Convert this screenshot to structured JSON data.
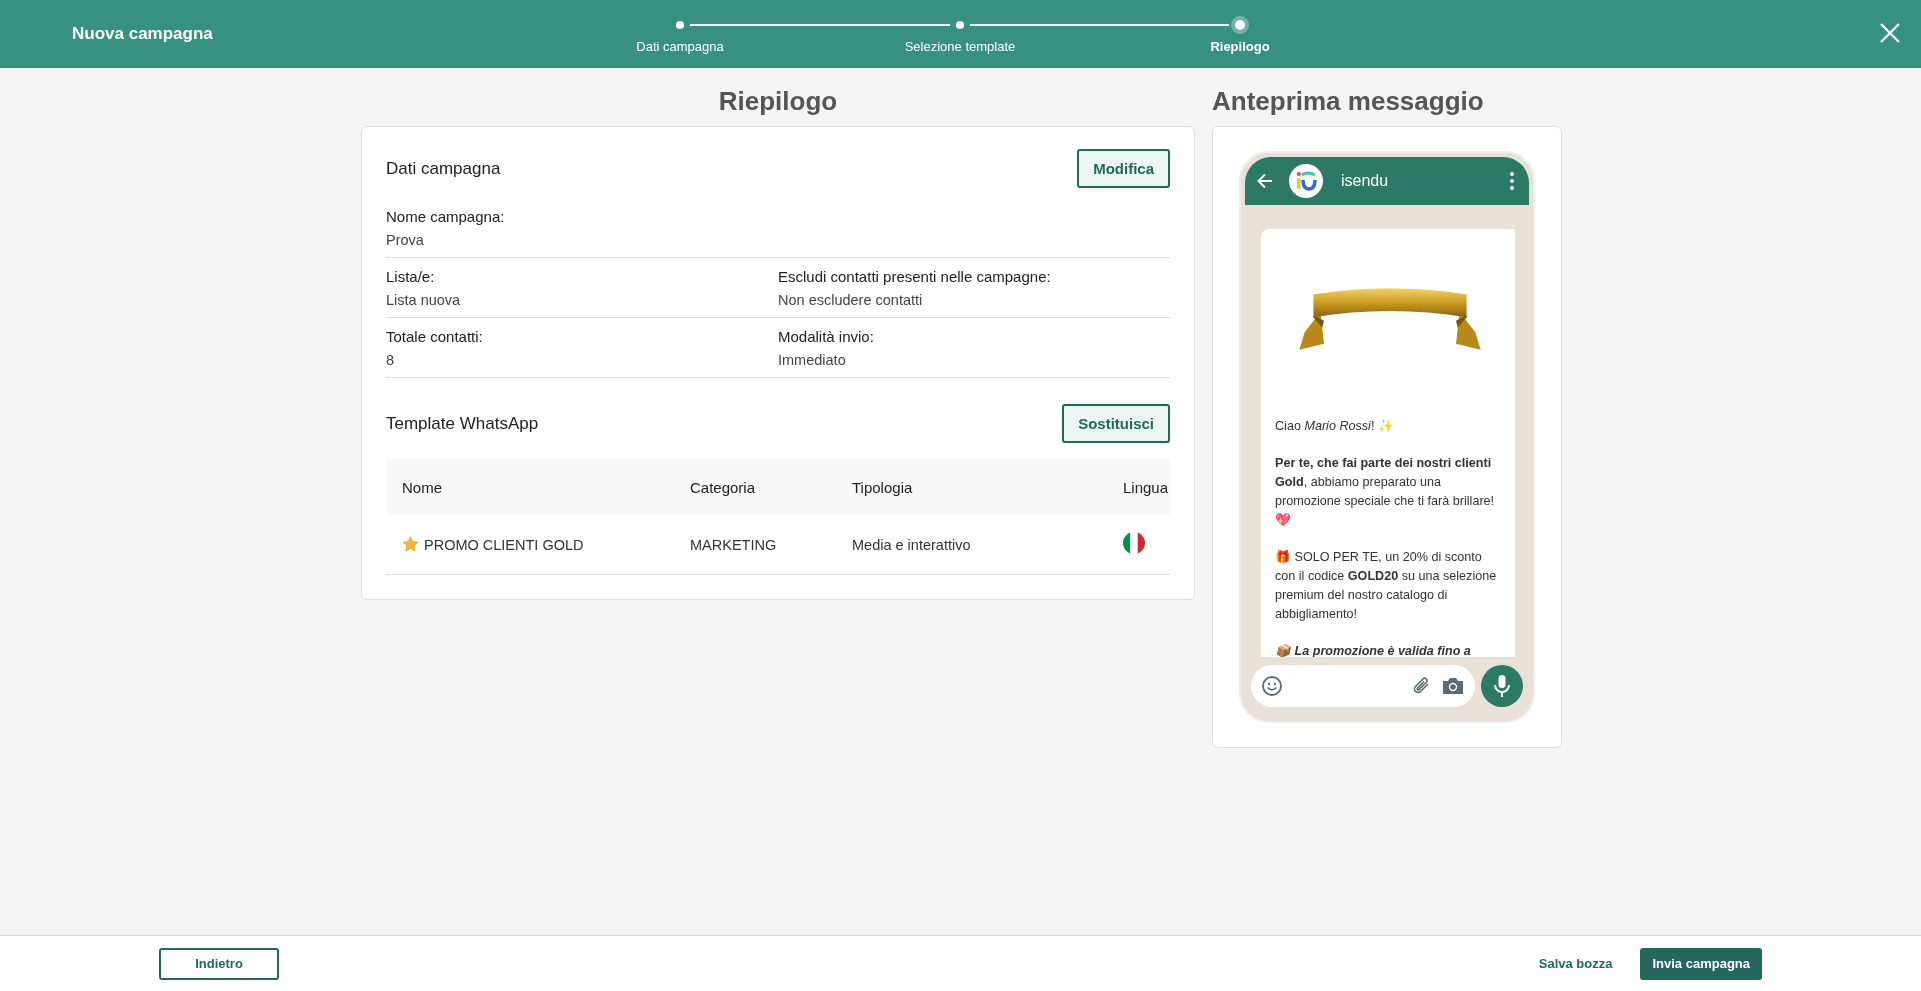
{
  "header": {
    "title": "Nuova campagna",
    "steps": [
      {
        "label": "Dati campagna",
        "selected": false
      },
      {
        "label": "Selezione template",
        "selected": false
      },
      {
        "label": "Riepilogo",
        "selected": true
      }
    ]
  },
  "summary": {
    "heading": "Riepilogo",
    "section_title": "Dati campagna",
    "edit_button": "Modifica",
    "field_rows": [
      [
        {
          "label": "Nome campagna:",
          "value": "Prova"
        }
      ],
      [
        {
          "label": "Lista/e:",
          "value": "Lista nuova"
        },
        {
          "label": "Escludi contatti presenti nelle campagne:",
          "value": "Non escludere contatti"
        }
      ],
      [
        {
          "label": "Totale contatti:",
          "value": "8"
        },
        {
          "label": "Modalità invio:",
          "value": "Immediato"
        }
      ]
    ],
    "template_title": "Template WhatsApp",
    "replace_button": "Sostituisci",
    "table": {
      "columns": [
        "Nome",
        "Categoria",
        "Tipologia",
        "Lingua"
      ],
      "rows": [
        {
          "name": "PROMO CLIENTI GOLD",
          "category": "MARKETING",
          "type": "Media e interattivo"
        }
      ]
    }
  },
  "preview": {
    "heading": "Anteprima messaggio",
    "contact": "isendu",
    "paragraphs": [
      {
        "kind": "plain",
        "text": "Ciao *Mario Rossi*! ✨"
      },
      {
        "kind": "plain",
        "text": "**Per te, che fai parte dei nostri clienti Gold**, abbiamo preparato una promozione speciale che ti farà brillare! 💖"
      },
      {
        "kind": "plain",
        "text": "🎁 SOLO PER TE, un 20% di sconto con il codice **GOLD20** su una selezione premium del nostro catalogo di abbigliamento!"
      },
      {
        "kind": "emphasis",
        "text": "📦 La promozione è valida fino a"
      }
    ]
  },
  "footer": {
    "back_button": "Indietro",
    "draft_button": "Salva bozza",
    "send_button": "Invia campagna"
  }
}
